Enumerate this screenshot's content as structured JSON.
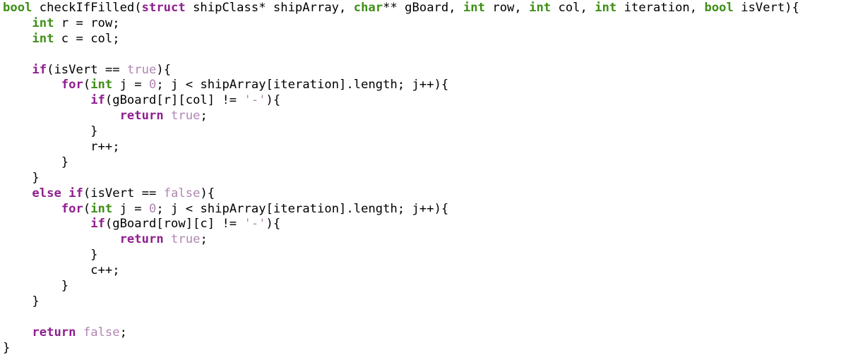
{
  "editor": {
    "language": "c",
    "colors": {
      "type": "#3f8f17",
      "keyword": "#8f1f8f",
      "literal": "#b085b3",
      "plain": "#000000",
      "background": "#ffffff"
    },
    "lines": [
      [
        [
          "type",
          "bool"
        ],
        [
          "plain",
          " checkIfFilled("
        ],
        [
          "kw",
          "struct"
        ],
        [
          "plain",
          " shipClass* shipArray, "
        ],
        [
          "type",
          "char"
        ],
        [
          "plain",
          "** gBoard, "
        ],
        [
          "type",
          "int"
        ],
        [
          "plain",
          " row, "
        ],
        [
          "type",
          "int"
        ],
        [
          "plain",
          " col, "
        ],
        [
          "type",
          "int"
        ],
        [
          "plain",
          " iteration, "
        ],
        [
          "type",
          "bool"
        ],
        [
          "plain",
          " isVert){"
        ]
      ],
      [
        [
          "plain",
          "    "
        ],
        [
          "type",
          "int"
        ],
        [
          "plain",
          " r = row;"
        ]
      ],
      [
        [
          "plain",
          "    "
        ],
        [
          "type",
          "int"
        ],
        [
          "plain",
          " c = col;"
        ]
      ],
      [],
      [
        [
          "plain",
          "    "
        ],
        [
          "kw",
          "if"
        ],
        [
          "plain",
          "(isVert == "
        ],
        [
          "lit",
          "true"
        ],
        [
          "plain",
          "){"
        ]
      ],
      [
        [
          "plain",
          "        "
        ],
        [
          "kw",
          "for"
        ],
        [
          "plain",
          "("
        ],
        [
          "type",
          "int"
        ],
        [
          "plain",
          " j = "
        ],
        [
          "lit",
          "0"
        ],
        [
          "plain",
          "; j < shipArray[iteration].length; j++){"
        ]
      ],
      [
        [
          "plain",
          "            "
        ],
        [
          "kw",
          "if"
        ],
        [
          "plain",
          "(gBoard[r][col] != "
        ],
        [
          "lit",
          "'-'"
        ],
        [
          "plain",
          "){"
        ]
      ],
      [
        [
          "plain",
          "                "
        ],
        [
          "kw",
          "return"
        ],
        [
          "plain",
          " "
        ],
        [
          "lit",
          "true"
        ],
        [
          "plain",
          ";"
        ]
      ],
      [
        [
          "plain",
          "            }"
        ]
      ],
      [
        [
          "plain",
          "            r++;"
        ]
      ],
      [
        [
          "plain",
          "        }"
        ]
      ],
      [
        [
          "plain",
          "    }"
        ]
      ],
      [
        [
          "plain",
          "    "
        ],
        [
          "kw",
          "else"
        ],
        [
          "plain",
          " "
        ],
        [
          "kw",
          "if"
        ],
        [
          "plain",
          "(isVert == "
        ],
        [
          "lit",
          "false"
        ],
        [
          "plain",
          "){"
        ]
      ],
      [
        [
          "plain",
          "        "
        ],
        [
          "kw",
          "for"
        ],
        [
          "plain",
          "("
        ],
        [
          "type",
          "int"
        ],
        [
          "plain",
          " j = "
        ],
        [
          "lit",
          "0"
        ],
        [
          "plain",
          "; j < shipArray[iteration].length; j++){"
        ]
      ],
      [
        [
          "plain",
          "            "
        ],
        [
          "kw",
          "if"
        ],
        [
          "plain",
          "(gBoard[row][c] != "
        ],
        [
          "lit",
          "'-'"
        ],
        [
          "plain",
          "){"
        ]
      ],
      [
        [
          "plain",
          "                "
        ],
        [
          "kw",
          "return"
        ],
        [
          "plain",
          " "
        ],
        [
          "lit",
          "true"
        ],
        [
          "plain",
          ";"
        ]
      ],
      [
        [
          "plain",
          "            }"
        ]
      ],
      [
        [
          "plain",
          "            c++;"
        ]
      ],
      [
        [
          "plain",
          "        }"
        ]
      ],
      [
        [
          "plain",
          "    }"
        ]
      ],
      [],
      [
        [
          "plain",
          "    "
        ],
        [
          "kw",
          "return"
        ],
        [
          "plain",
          " "
        ],
        [
          "lit",
          "false"
        ],
        [
          "plain",
          ";"
        ]
      ],
      [
        [
          "plain",
          "}"
        ]
      ]
    ]
  }
}
